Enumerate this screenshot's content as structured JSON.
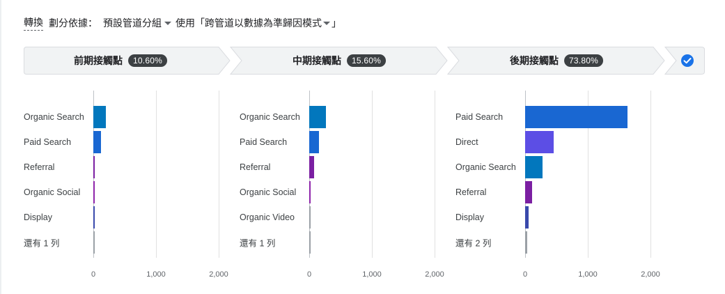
{
  "header": {
    "conversion_label": "轉換",
    "split_by_label": "劃分依據：",
    "grouping_value": "預設管道分組",
    "use_label": "使用",
    "model_value": "「跨管道以數據為準歸因模式",
    "model_close": "」"
  },
  "stages": [
    {
      "label": "前期接觸點",
      "percent": "10.60%"
    },
    {
      "label": "中期接觸點",
      "percent": "15.60%"
    },
    {
      "label": "後期接觸點",
      "percent": "73.80%"
    }
  ],
  "colors": {
    "organic_search": "#0277bd",
    "paid_search": "#1967d2",
    "referral": "#7b1fa2",
    "organic_social": "#8e24aa",
    "direct": "#5c4ee5",
    "display": "#3949ab",
    "other": "#9aa0a6",
    "check": "#1a73e8"
  },
  "chart_data": [
    {
      "type": "bar",
      "orientation": "horizontal",
      "stage": "前期接觸點",
      "categories": [
        "Organic Search",
        "Paid Search",
        "Referral",
        "Organic Social",
        "Display",
        "還有 1 列"
      ],
      "values": [
        200,
        120,
        18,
        12,
        4,
        3
      ],
      "xlim": [
        0,
        2000
      ],
      "x_ticks": [
        "0",
        "1,000",
        "2,000"
      ],
      "grid": true
    },
    {
      "type": "bar",
      "orientation": "horizontal",
      "stage": "中期接觸點",
      "categories": [
        "Organic Search",
        "Paid Search",
        "Referral",
        "Organic Social",
        "Organic Video",
        "還有 1 列"
      ],
      "values": [
        270,
        150,
        75,
        15,
        3,
        3
      ],
      "xlim": [
        0,
        2000
      ],
      "x_ticks": [
        "0",
        "1,000",
        "2,000"
      ],
      "grid": true
    },
    {
      "type": "bar",
      "orientation": "horizontal",
      "stage": "後期接觸點",
      "categories": [
        "Paid Search",
        "Direct",
        "Organic Search",
        "Referral",
        "Display",
        "還有 2 列"
      ],
      "values": [
        1630,
        450,
        280,
        115,
        60,
        35
      ],
      "xlim": [
        0,
        2000
      ],
      "x_ticks": [
        "0",
        "1,000",
        "2,000"
      ],
      "grid": true
    }
  ],
  "bar_color_keys": [
    [
      "organic_search",
      "paid_search",
      "referral",
      "organic_social",
      "display",
      "other"
    ],
    [
      "organic_search",
      "paid_search",
      "referral",
      "organic_social",
      "other",
      "other"
    ],
    [
      "paid_search",
      "direct",
      "organic_search",
      "referral",
      "display",
      "other"
    ]
  ]
}
